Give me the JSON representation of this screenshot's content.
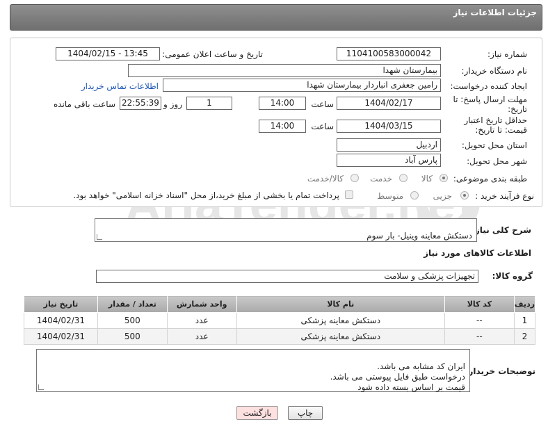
{
  "header": {
    "title": "جزئیات اطلاعات نیاز"
  },
  "fields": {
    "need_number_label": "شماره نیاز:",
    "need_number": "1104100583000042",
    "announce_label": "تاریخ و ساعت اعلان عمومی:",
    "announce_value": "1404/02/15 - 13:45",
    "buyer_org_label": "نام دستگاه خریدار:",
    "buyer_org": "بیمارستان شهدا",
    "creator_label": "ایجاد کننده درخواست:",
    "creator": "رامین جعفری انباردار بیمارستان شهدا",
    "contact_link": "اطلاعات تماس خریدار",
    "reply_deadline_label": "مهلت ارسال پاسخ: تا تاریخ:",
    "reply_date": "1404/02/17",
    "time_label": "ساعت",
    "reply_time": "14:00",
    "days_value": "1",
    "days_label": "روز و",
    "remaining_time": "22:55:39",
    "remaining_label": "ساعت باقی مانده",
    "price_validity_label": "حداقل تاریخ اعتبار قیمت: تا تاریخ:",
    "price_date": "1404/03/15",
    "price_time": "14:00",
    "province_label": "استان محل تحویل:",
    "province": "اردبیل",
    "city_label": "شهر محل تحویل:",
    "city": "پارس آباد",
    "category_label": "طبقه بندی موضوعی:",
    "category_options": [
      "کالا",
      "خدمت",
      "کالا/خدمت"
    ],
    "process_label": "نوع فرآیند خرید :",
    "process_options": [
      "جزیی",
      "متوسط"
    ],
    "payment_note": "پرداخت تمام یا بخشی از مبلغ خرید،از محل \"اسناد خزانه اسلامی\" خواهد بود."
  },
  "description": {
    "label": "شرح کلی نیاز:",
    "value": "دستکش معاینه وینیل- بار سوم"
  },
  "goods_section": {
    "title": "اطلاعات کالاهای مورد نیاز",
    "group_label": "گروه کالا:",
    "group_value": "تجهیزات پزشکی و سلامت"
  },
  "table": {
    "headers": [
      "ردیف",
      "کد کالا",
      "نام کالا",
      "واحد شمارش",
      "تعداد / مقدار",
      "تاریخ نیاز"
    ],
    "rows": [
      [
        "1",
        "--",
        "دستکش معاینه پزشکی",
        "عدد",
        "500",
        "1404/02/31"
      ],
      [
        "2",
        "--",
        "دستکش معاینه پزشکی",
        "عدد",
        "500",
        "1404/02/31"
      ]
    ]
  },
  "buyer_notes": {
    "label": "توضیحات خریدار:",
    "value": "ایران کد مشابه می باشد.\nدرخواست طبق فایل پیوستی می باشد.\nقیمت بر اساس بسته داده شود"
  },
  "buttons": {
    "print": "چاپ",
    "back": "بازگشت"
  },
  "watermark": {
    "text": "AriaTender.neT"
  },
  "colors": {
    "header_bg": "#7f7f7f",
    "link": "#1f56b8",
    "back_button_bg": "#fde0e0"
  }
}
